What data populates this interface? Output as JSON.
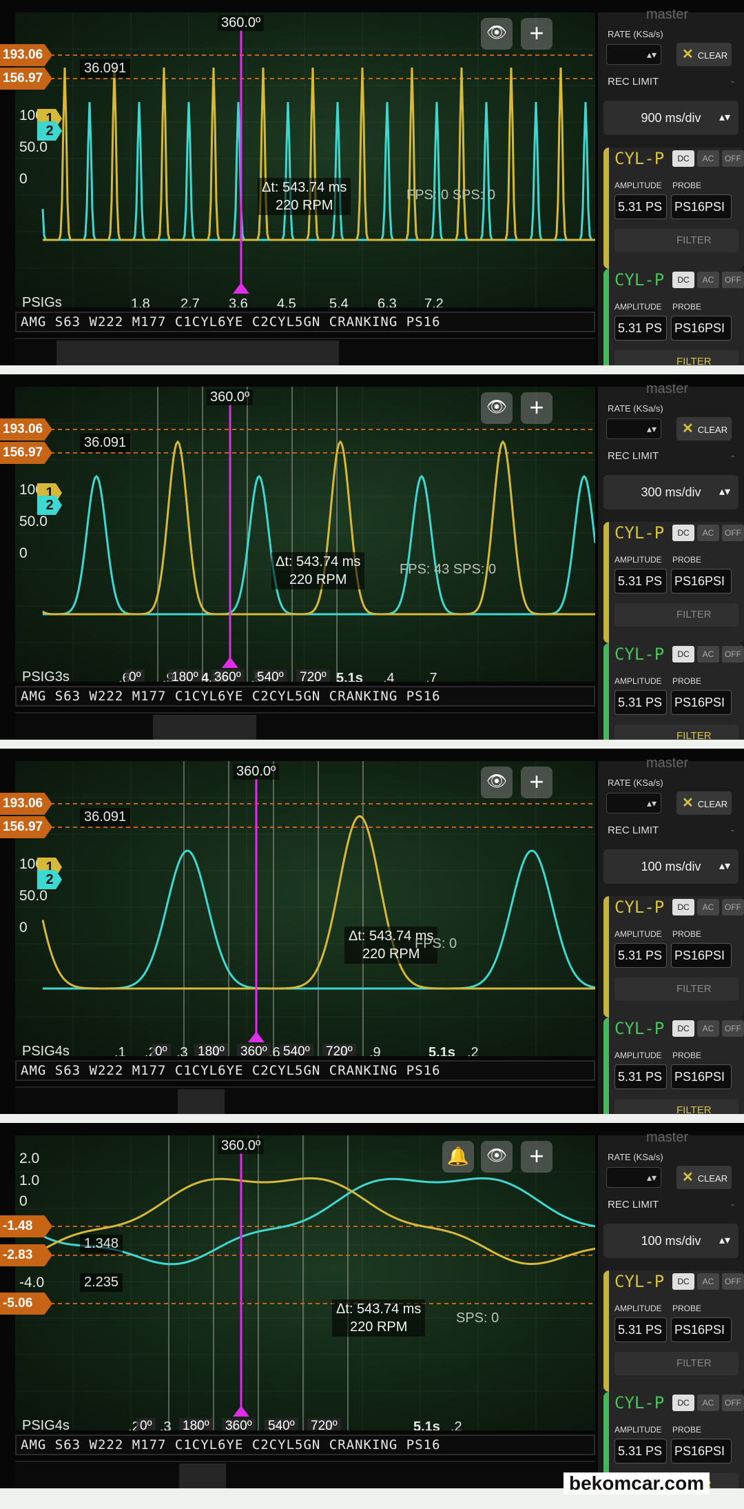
{
  "panels": [
    {
      "cursor_angle": "360.0º",
      "markers": [
        {
          "label": "193.06"
        },
        {
          "label": "156.97"
        }
      ],
      "delta_label": "36.091",
      "y_ticks": [
        "100",
        "50.0",
        "0"
      ],
      "x_unit": "PSIGs",
      "x_ticks": [
        "1.8",
        "2.7",
        "3.6",
        "5.4",
        "6.3",
        "7.2"
      ],
      "dt": "Δt: 543.74 ms",
      "rpm": "220 RPM",
      "fps": "FPS: 0  SPS: 0",
      "timebase": "900 ms/div",
      "degree_chips": [],
      "mid_label": "4.5"
    },
    {
      "cursor_angle": "360.0º",
      "markers": [
        {
          "label": "193.06"
        },
        {
          "label": "156.97"
        }
      ],
      "delta_label": "36.091",
      "y_ticks": [
        "100",
        "50.0",
        "0"
      ],
      "x_unit": "PSIG3s",
      "x_ticks": [
        ".6",
        ".9",
        "4.2s",
        "5.1s",
        ".4",
        ".7"
      ],
      "dt": "Δt: 543.74 ms",
      "rpm": "220 RPM",
      "fps": "FPS: 43  SPS: 0",
      "timebase": "300 ms/div",
      "degree_chips": [
        "0º",
        "180º",
        "360º",
        "540º",
        "720º"
      ],
      "mid_label": ".5"
    },
    {
      "cursor_angle": "360.0º",
      "markers": [
        {
          "label": "193.06"
        },
        {
          "label": "156.97"
        }
      ],
      "delta_label": "36.091",
      "y_ticks": [
        "100",
        "50.0",
        "0"
      ],
      "x_unit": "PSIG4s",
      "x_ticks": [
        ".1",
        ".2",
        ".3",
        ".4",
        ".8",
        ".9",
        "5.1s",
        ".2"
      ],
      "dt": "Δt: 543.74 ms",
      "rpm": "220 RPM",
      "fps": "FPS: 0",
      "timebase": "100 ms/div",
      "degree_chips": [
        "0º",
        "180º",
        "360º",
        "540º",
        "720º"
      ],
      "mid_label": ".6"
    },
    {
      "cursor_angle": "360.0º",
      "markers": [
        {
          "label": "-1.48"
        },
        {
          "label": "-2.83"
        },
        {
          "label": "-5.06"
        }
      ],
      "delta_labels": [
        "1.348",
        "2.235"
      ],
      "y_ticks": [
        "2.0",
        "1.0",
        "0",
        "-1.0",
        "-4.0"
      ],
      "x_unit": "PSIG4s",
      "x_ticks": [
        ".2",
        ".3",
        ".4",
        ".5",
        ".8",
        "5.1s",
        ".2"
      ],
      "dt": "Δt: 543.74 ms",
      "rpm": "220 RPM",
      "fps": "SPS: 0",
      "timebase": "100 ms/div",
      "degree_chips": [
        "0º",
        "180º",
        "360º",
        "540º",
        "720º"
      ],
      "mid_label": ".6"
    }
  ],
  "common": {
    "title": "AMG S63 W222 M177 C1CYL6YE C2CYL5GN CRANKING PS16",
    "side_top": "master",
    "rate_label": "RATE (KSa/s)",
    "clear_label": "CLEAR",
    "rec_limit": "REC LIMIT",
    "rec_dash": "-",
    "channel_name": "CYL-P",
    "coupling": [
      "DC",
      "AC",
      "OFF"
    ],
    "amplitude_label": "AMPLITUDE",
    "probe_label": "PROBE",
    "amplitude_value": "5.31 PS",
    "probe_value": "PS16PSI",
    "filter_label": "FILTER",
    "ch1_badge": "1",
    "ch2_badge": "2"
  },
  "colors": {
    "ch1": "#d6b93a",
    "ch2": "#3fd8d0",
    "cursor": "#e02de8",
    "marker": "#c76416"
  },
  "watermark": "bekomcar.com"
}
